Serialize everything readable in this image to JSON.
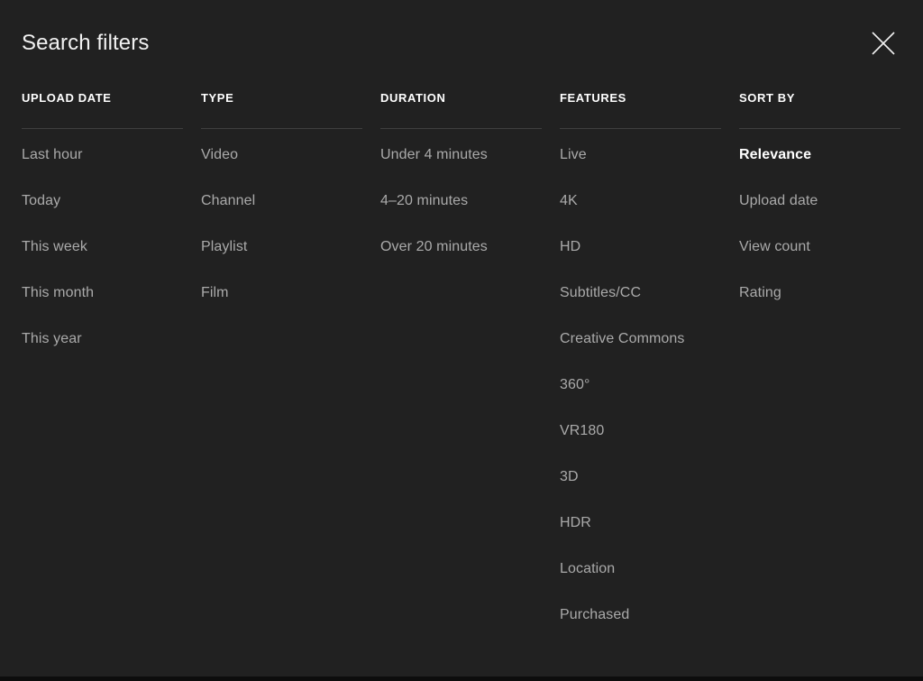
{
  "panel": {
    "title": "Search filters",
    "close_icon": "close-icon",
    "background_color": "#212121",
    "text_color": "#aaaaaa",
    "selected_text_color": "#ffffff",
    "divider_color": "#3f3f3f"
  },
  "columns": [
    {
      "id": "upload-date",
      "header": "UPLOAD DATE",
      "items": [
        {
          "label": "Last hour",
          "selected": false
        },
        {
          "label": "Today",
          "selected": false
        },
        {
          "label": "This week",
          "selected": false
        },
        {
          "label": "This month",
          "selected": false
        },
        {
          "label": "This year",
          "selected": false
        }
      ]
    },
    {
      "id": "type",
      "header": "TYPE",
      "items": [
        {
          "label": "Video",
          "selected": false
        },
        {
          "label": "Channel",
          "selected": false
        },
        {
          "label": "Playlist",
          "selected": false
        },
        {
          "label": "Film",
          "selected": false
        }
      ]
    },
    {
      "id": "duration",
      "header": "DURATION",
      "items": [
        {
          "label": "Under 4 minutes",
          "selected": false
        },
        {
          "label": "4–20 minutes",
          "selected": false
        },
        {
          "label": "Over 20 minutes",
          "selected": false
        }
      ]
    },
    {
      "id": "features",
      "header": "FEATURES",
      "items": [
        {
          "label": "Live",
          "selected": false
        },
        {
          "label": "4K",
          "selected": false
        },
        {
          "label": "HD",
          "selected": false
        },
        {
          "label": "Subtitles/CC",
          "selected": false
        },
        {
          "label": "Creative Commons",
          "selected": false
        },
        {
          "label": "360°",
          "selected": false
        },
        {
          "label": "VR180",
          "selected": false
        },
        {
          "label": "3D",
          "selected": false
        },
        {
          "label": "HDR",
          "selected": false
        },
        {
          "label": "Location",
          "selected": false
        },
        {
          "label": "Purchased",
          "selected": false
        }
      ]
    },
    {
      "id": "sort-by",
      "header": "SORT BY",
      "items": [
        {
          "label": "Relevance",
          "selected": true
        },
        {
          "label": "Upload date",
          "selected": false
        },
        {
          "label": "View count",
          "selected": false
        },
        {
          "label": "Rating",
          "selected": false
        }
      ]
    }
  ]
}
